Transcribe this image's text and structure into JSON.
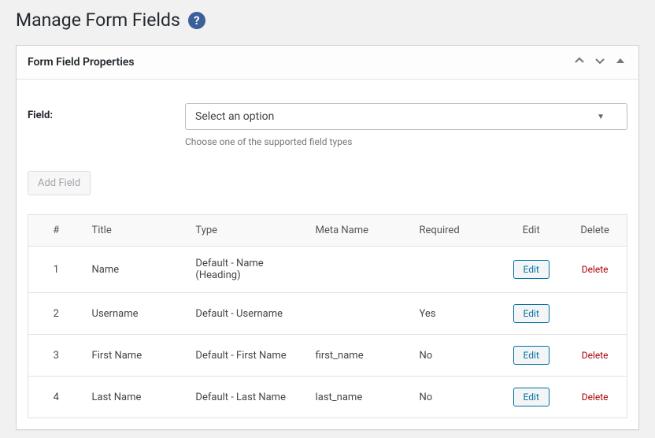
{
  "header": {
    "title": "Manage Form Fields"
  },
  "panel": {
    "title": "Form Field Properties"
  },
  "field_selector": {
    "label": "Field:",
    "selected": "Select an option",
    "help_text": "Choose one of the supported field types"
  },
  "add_field_button": "Add Field",
  "table": {
    "headers": {
      "index": "#",
      "title": "Title",
      "type": "Type",
      "meta": "Meta Name",
      "required": "Required",
      "edit": "Edit",
      "delete": "Delete"
    },
    "rows": [
      {
        "index": "1",
        "title": "Name",
        "type": "Default - Name (Heading)",
        "meta": "",
        "required": "",
        "edit": "Edit",
        "delete": "Delete"
      },
      {
        "index": "2",
        "title": "Username",
        "type": "Default - Username",
        "meta": "",
        "required": "Yes",
        "edit": "Edit",
        "delete": ""
      },
      {
        "index": "3",
        "title": "First Name",
        "type": "Default - First Name",
        "meta": "first_name",
        "required": "No",
        "edit": "Edit",
        "delete": "Delete"
      },
      {
        "index": "4",
        "title": "Last Name",
        "type": "Default - Last Name",
        "meta": "last_name",
        "required": "No",
        "edit": "Edit",
        "delete": "Delete"
      }
    ]
  }
}
